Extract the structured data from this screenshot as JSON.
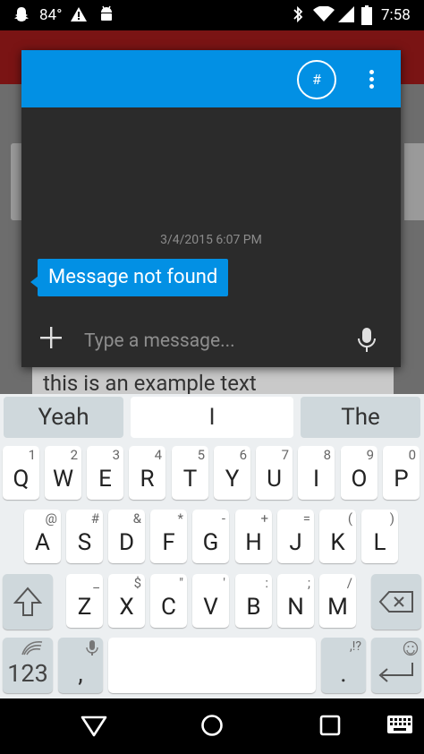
{
  "status_bar": {
    "temperature": "84°",
    "time": "7:58",
    "icons": [
      "snapchat-icon",
      "alert-icon",
      "android-icon",
      "bluetooth-icon",
      "wifi-icon",
      "signal-icon",
      "battery-icon"
    ]
  },
  "background_app": {
    "text_field_value": "this is an example text"
  },
  "dialog": {
    "header_button_label": "#",
    "timestamp": "3/4/2015 6:07 PM",
    "message_text": "Message not found",
    "input_placeholder": "Type a message..."
  },
  "keyboard": {
    "suggestions": [
      "Yeah",
      "I",
      "The"
    ],
    "row1": [
      {
        "key": "Q",
        "hint": "1"
      },
      {
        "key": "W",
        "hint": "2"
      },
      {
        "key": "E",
        "hint": "3"
      },
      {
        "key": "R",
        "hint": "4"
      },
      {
        "key": "T",
        "hint": "5"
      },
      {
        "key": "Y",
        "hint": "6"
      },
      {
        "key": "U",
        "hint": "7"
      },
      {
        "key": "I",
        "hint": "8"
      },
      {
        "key": "O",
        "hint": "9"
      },
      {
        "key": "P",
        "hint": "0"
      }
    ],
    "row2": [
      {
        "key": "A",
        "hint": "@"
      },
      {
        "key": "S",
        "hint": "#"
      },
      {
        "key": "D",
        "hint": "&"
      },
      {
        "key": "F",
        "hint": "*"
      },
      {
        "key": "G",
        "hint": "-"
      },
      {
        "key": "H",
        "hint": "+"
      },
      {
        "key": "J",
        "hint": "="
      },
      {
        "key": "K",
        "hint": "("
      },
      {
        "key": "L",
        "hint": ")"
      }
    ],
    "row3": [
      {
        "key": "Z",
        "hint": "_"
      },
      {
        "key": "X",
        "hint": "$"
      },
      {
        "key": "C",
        "hint": "\""
      },
      {
        "key": "V",
        "hint": "'"
      },
      {
        "key": "B",
        "hint": ":"
      },
      {
        "key": "N",
        "hint": ";"
      },
      {
        "key": "M",
        "hint": "/"
      }
    ],
    "symbols_key_label": "123",
    "comma_key": ",",
    "period_key": ".",
    "period_key_hint": ",!?"
  },
  "colors": {
    "accent": "#0290e4",
    "dialog_bg": "#2b2b2b",
    "keyboard_bg": "#eceff1"
  }
}
